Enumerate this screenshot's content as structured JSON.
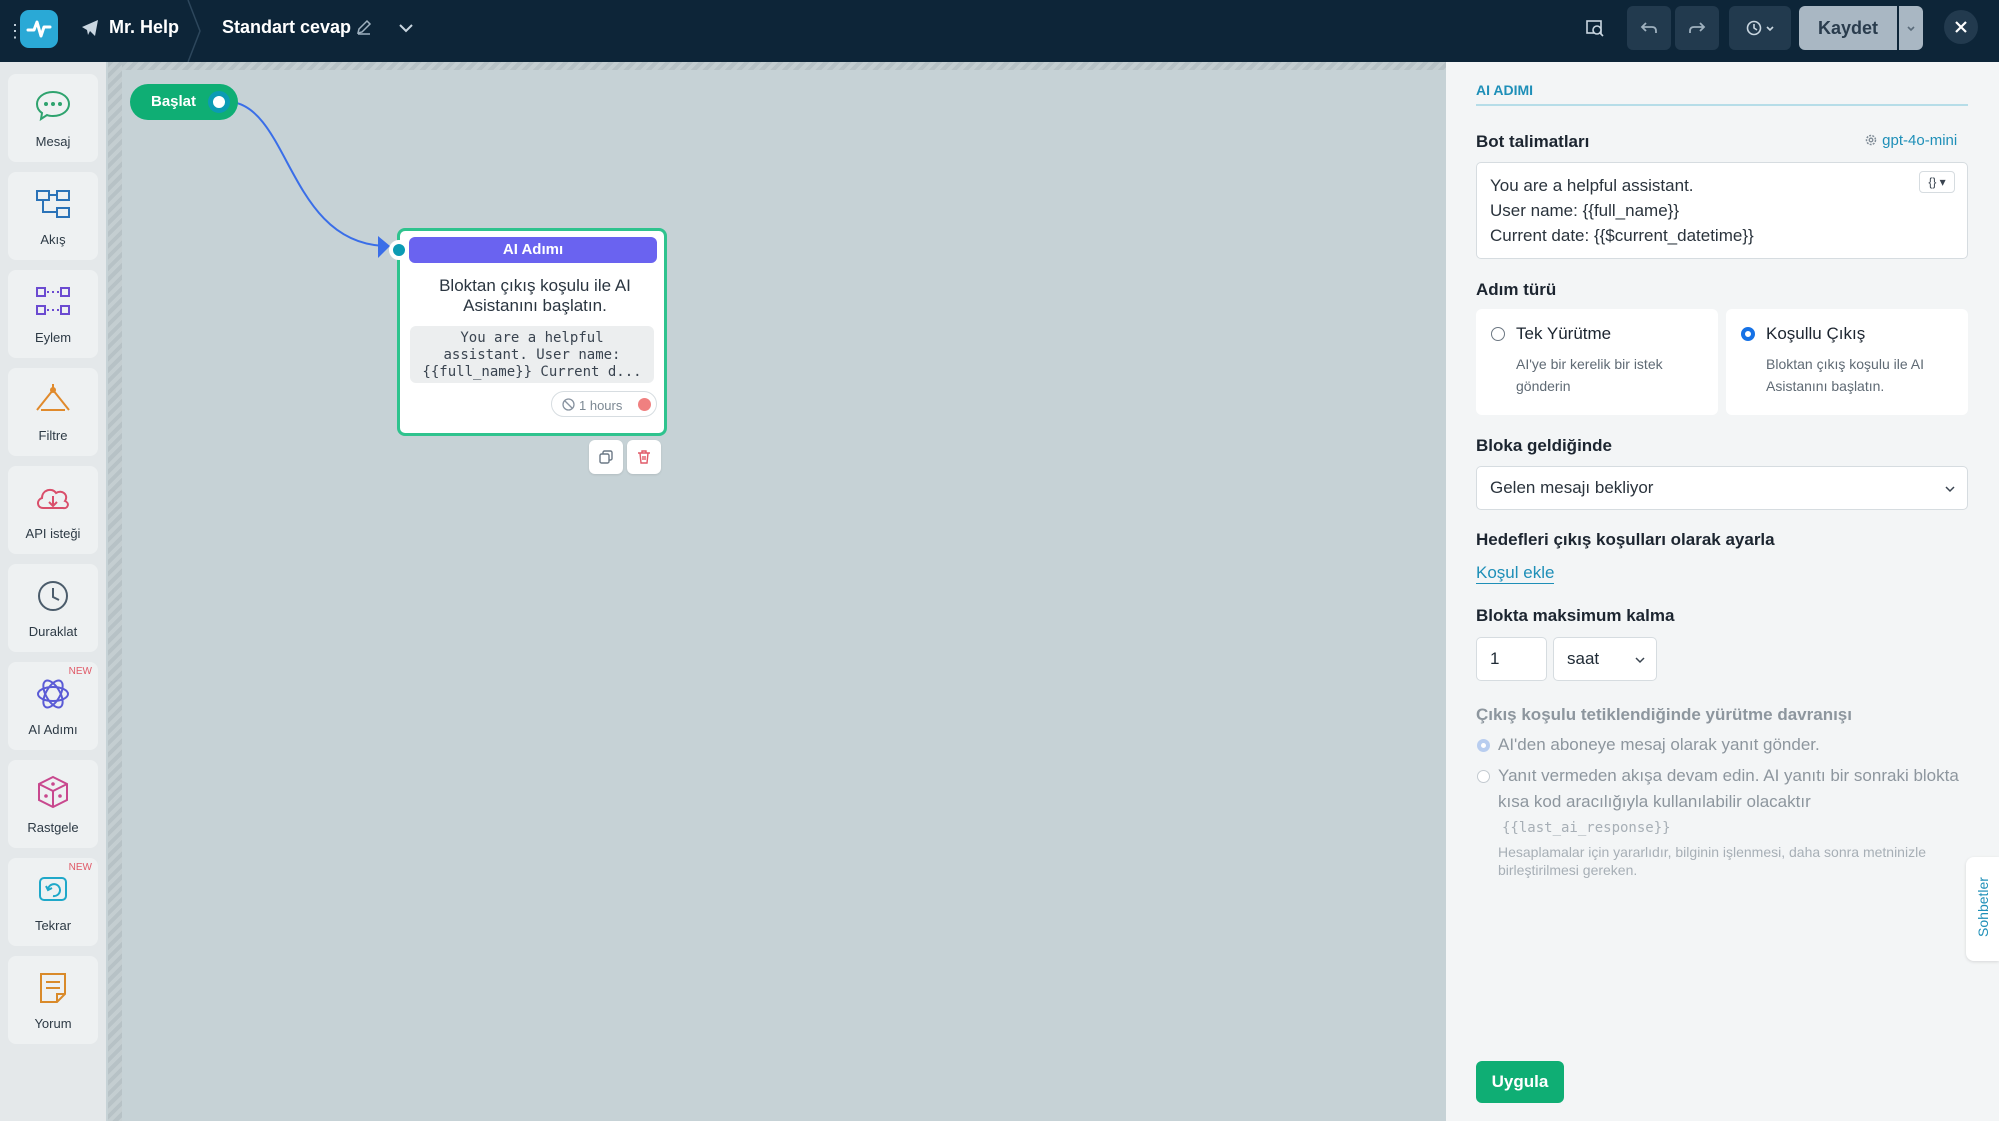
{
  "topbar": {
    "bot_name": "Mr. Help",
    "flow_name": "Standart cevap",
    "save_label": "Kaydet"
  },
  "sidebar": {
    "items": [
      {
        "label": "Mesaj",
        "icon": "chat-bubble-icon"
      },
      {
        "label": "Akış",
        "icon": "flow-icon"
      },
      {
        "label": "Eylem",
        "icon": "action-icon"
      },
      {
        "label": "Filtre",
        "icon": "filter-icon"
      },
      {
        "label": "API isteği",
        "icon": "cloud-icon"
      },
      {
        "label": "Duraklat",
        "icon": "clock-icon"
      },
      {
        "label": "AI Adımı",
        "icon": "ai-icon",
        "badge": "NEW"
      },
      {
        "label": "Rastgele",
        "icon": "dice-icon"
      },
      {
        "label": "Tekrar",
        "icon": "repeat-icon",
        "badge": "NEW"
      },
      {
        "label": "Yorum",
        "icon": "note-icon"
      }
    ]
  },
  "canvas": {
    "start_node": {
      "label": "Başlat"
    },
    "ai_node": {
      "header": "AI Adımı",
      "description": "Bloktan çıkış koşulu ile AI Asistanını başlatın.",
      "code_preview": "You are a helpful assistant. User name: {{full_name}} Current d...",
      "timeout": "1 hours"
    }
  },
  "panel": {
    "tab": "AI ADIMI",
    "bot_instructions": {
      "heading": "Bot talimatları",
      "model": "gpt-4o-mini",
      "line1": "You are a helpful assistant.",
      "line2": "User name:  {{full_name}}",
      "line3": "Current date:  {{$current_datetime}}",
      "var_button": "{}"
    },
    "step_type": {
      "heading": "Adım türü",
      "single": {
        "title": "Tek Yürütme",
        "subtitle": "AI'ye bir kerelik bir istek gönderin",
        "selected": false
      },
      "conditional": {
        "title": "Koşullu Çıkış",
        "subtitle": "Bloktan çıkış koşulu ile AI Asistanını başlatın.",
        "selected": true
      }
    },
    "on_arrival": {
      "heading": "Bloka geldiğinde",
      "value": "Gelen mesajı bekliyor"
    },
    "targets": {
      "heading": "Hedefleri çıkış koşulları olarak ayarla",
      "link": "Koşul ekle"
    },
    "max_stay": {
      "heading": "Blokta maksimum kalma",
      "value": "1",
      "unit": "saat"
    },
    "behavior": {
      "heading": "Çıkış koşulu tetiklendiğinde yürütme davranışı",
      "option1": "AI'den aboneye mesaj olarak yanıt gönder.",
      "option2": "Yanıt vermeden akışa devam edin. AI yanıtı bir sonraki blokta kısa kod aracılığıyla kullanılabilir olacaktır",
      "code": "{{last_ai_response}}",
      "note": "Hesaplamalar için yararlıdır, bilginin işlenmesi, daha sonra metninizle birleştirilmesi gereken."
    },
    "apply_label": "Uygula",
    "chats_tab": "Sohbetler"
  },
  "colors": {
    "topbar_bg": "#0d2538",
    "accent_green": "#0fae74",
    "ai_header": "#6a63f0",
    "link_blue": "#1e8fb8"
  }
}
